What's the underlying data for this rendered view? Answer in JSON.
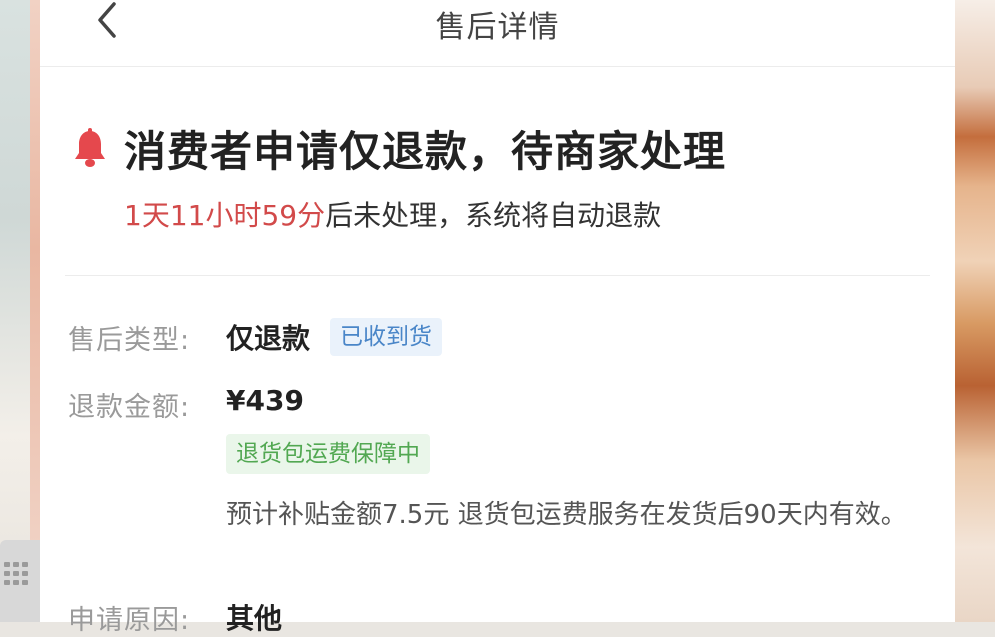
{
  "navbar": {
    "title": "售后详情",
    "back_icon": "chevron-left-icon"
  },
  "status": {
    "title": "消费者申请仅退款，待商家处理",
    "countdown": "1天11小时59分",
    "countdown_suffix": "后未处理，系统将自动退款",
    "icon": "bell-icon",
    "icon_color": "#e5484d",
    "countdown_color": "#d24a4a"
  },
  "details": {
    "type_label": "售后类型:",
    "type_value": "仅退款",
    "type_tag": "已收到货",
    "amount_label": "退款金额:",
    "amount_value": "¥439",
    "shipping_tag": "退货包运费保障中",
    "shipping_note": "预计补贴金额7.5元 退货包运费服务在发货后90天内有效。",
    "reason_label": "申请原因:",
    "reason_value": "其他"
  }
}
